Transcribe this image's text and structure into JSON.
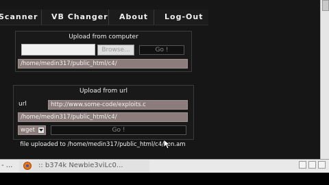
{
  "nav": {
    "items": [
      "Scanner",
      "VB Changer",
      "About",
      "Log-Out"
    ],
    "hidden_items": [
      "",
      ""
    ]
  },
  "upload_computer": {
    "title": "Upload from computer",
    "browse_label": "Browse...",
    "go_label": "Go !",
    "path_value": "/home/medin317/public_html/c4/"
  },
  "upload_url": {
    "title": "Upload from url",
    "url_label": "url",
    "url_value": "http://www.some-code/exploits.c",
    "path_value": "/home/medin317/public_html/c4/",
    "method_value": "wget",
    "go_label": "Go !"
  },
  "status_message": "file uploaded to /home/medin317/public_html/c4/con.am",
  "taskbar": {
    "left_text": "- ...",
    "task_title": ":: b374k Newbie3viLc0..."
  },
  "colors": {
    "page_bg": "#161616",
    "field_bg": "#8c7c7c",
    "panel_border": "#3c3c3c"
  }
}
